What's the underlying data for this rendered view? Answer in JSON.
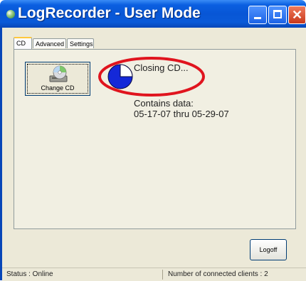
{
  "window": {
    "title": "LogRecorder - User Mode"
  },
  "tabs": [
    {
      "label": "CD",
      "active": true
    },
    {
      "label": "Advanced",
      "active": false
    },
    {
      "label": "Settings",
      "active": false
    }
  ],
  "cd_panel": {
    "change_cd_label": "Change CD",
    "status": "Closing CD...",
    "contains_label": "Contains data:",
    "date_range": "05-17-07 thru 05-29-07"
  },
  "buttons": {
    "logoff": "Logoff"
  },
  "statusbar": {
    "status": "Status : Online",
    "clients": "Number of connected clients : 2"
  },
  "colors": {
    "titlebar": "#0856d6",
    "highlight_ellipse": "#e0141e",
    "progress_fill": "#1428d8"
  },
  "icons": {
    "app": "app-icon",
    "change_cd": "cd-drive-icon",
    "progress": "progress-pie-icon"
  }
}
